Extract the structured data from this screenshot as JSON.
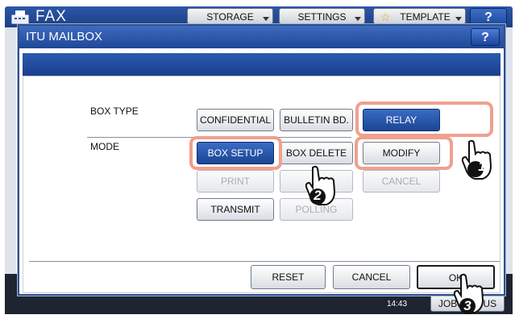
{
  "background": {
    "title": "FAX",
    "tabs": [
      "STORAGE",
      "SETTINGS",
      "TEMPLATE"
    ],
    "help_label": "?",
    "time": "14:43",
    "job_button": "JOB STATUS"
  },
  "dialog": {
    "title": "ITU MAILBOX",
    "help_label": "?",
    "box_type_label": "BOX TYPE",
    "mode_label": "MODE",
    "box_type_buttons": {
      "confidential": "CONFIDENTIAL",
      "bulletin": "BULLETIN BD.",
      "relay": "RELAY"
    },
    "mode_buttons": {
      "box_setup": "BOX SETUP",
      "box_delete": "BOX DELETE",
      "modify": "MODIFY",
      "print": "PRINT",
      "print_hidden": "",
      "cancel": "CANCEL",
      "transmit": "TRANSMIT",
      "polling": "POLLING"
    },
    "footer": {
      "reset": "RESET",
      "cancel": "CANCEL",
      "ok": "OK"
    }
  },
  "callouts": [
    "1",
    "2",
    "3"
  ],
  "colors": {
    "selected_blue": "#1c4594",
    "highlight_salmon": "#f0a08e",
    "title_blue": "#2b57a8"
  }
}
